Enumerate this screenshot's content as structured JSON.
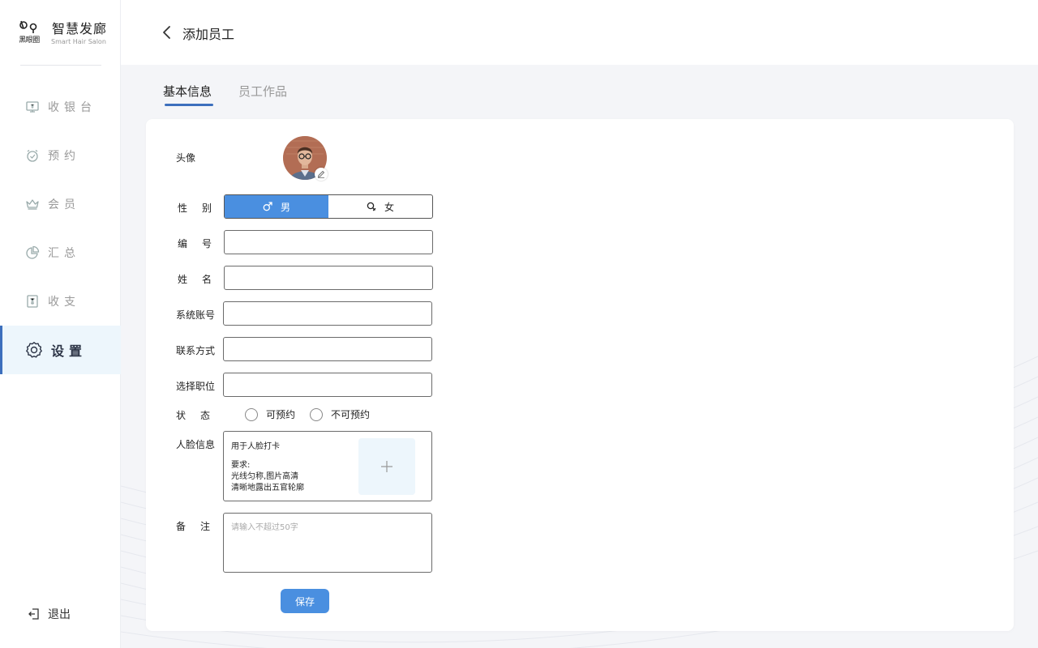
{
  "brand": {
    "logo_text": "黑眼圈",
    "name": "智慧发廊",
    "subtitle": "Smart Hair Salon"
  },
  "sidebar": {
    "items": [
      {
        "label": "收银台",
        "icon": "cashier-icon",
        "active": false
      },
      {
        "label": "预约",
        "icon": "alarm-clock-icon",
        "active": false
      },
      {
        "label": "会员",
        "icon": "crown-icon",
        "active": false
      },
      {
        "label": "汇总",
        "icon": "pie-chart-icon",
        "active": false
      },
      {
        "label": "收支",
        "icon": "yuan-ledger-icon",
        "active": false
      },
      {
        "label": "设置",
        "icon": "gear-icon",
        "active": true
      }
    ],
    "logout_label": "退出"
  },
  "header": {
    "title": "添加员工"
  },
  "tabs": [
    {
      "label": "基本信息",
      "active": true
    },
    {
      "label": "员工作品",
      "active": false
    }
  ],
  "form": {
    "avatar_label": "头像",
    "gender_label": "性别",
    "gender_options": [
      {
        "label": "男",
        "selected": true
      },
      {
        "label": "女",
        "selected": false
      }
    ],
    "number_label": "编号",
    "name_label": "姓名",
    "account_label": "系统账号",
    "contact_label": "联系方式",
    "position_label": "选择职位",
    "status_label": "状态",
    "status_options": [
      "可预约",
      "不可预约"
    ],
    "face_label": "人脸信息",
    "face_desc": "用于人脸打卡",
    "face_req_title": "要求:",
    "face_req_1": "光线匀称,图片高清",
    "face_req_2": "清晰地露出五官轮廓",
    "remark_label": "备注",
    "remark_placeholder": "请输入不超过50字",
    "save_label": "保存"
  },
  "colors": {
    "accent": "#4a8fe0",
    "active_bar": "#3d6fbd",
    "active_bg": "#edf6fc"
  }
}
